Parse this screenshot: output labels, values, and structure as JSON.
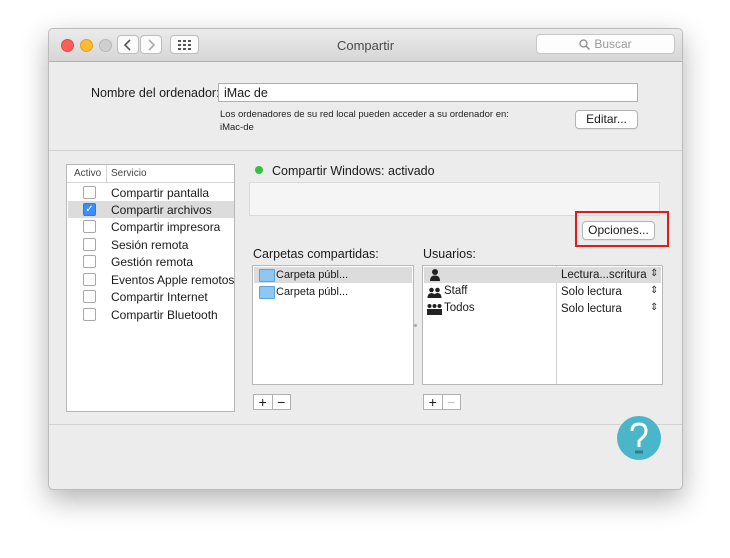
{
  "window": {
    "title": "Compartir"
  },
  "search": {
    "placeholder": "Buscar"
  },
  "computer_name": {
    "label": "Nombre del ordenador:",
    "value": "iMac de",
    "info_line1": "Los ordenadores de su red local pueden acceder a su ordenador en:",
    "info_line2": "iMac-de",
    "edit_button": "Editar..."
  },
  "services": {
    "header_active": "Activo",
    "header_service": "Servicio",
    "items": [
      {
        "label": "Compartir pantalla",
        "checked": false
      },
      {
        "label": "Compartir archivos",
        "checked": true
      },
      {
        "label": "Compartir impresora",
        "checked": false
      },
      {
        "label": "Sesión remota",
        "checked": false
      },
      {
        "label": "Gestión remota",
        "checked": false
      },
      {
        "label": "Eventos Apple remotos",
        "checked": false
      },
      {
        "label": "Compartir Internet",
        "checked": false
      },
      {
        "label": "Compartir Bluetooth",
        "checked": false
      }
    ]
  },
  "status": {
    "text": "Compartir Windows: activado",
    "color": "#2fc43b"
  },
  "options_button": "Opciones...",
  "shared_folders": {
    "label": "Carpetas compartidas:",
    "items": [
      "Carpeta públ...",
      "Carpeta públ..."
    ]
  },
  "users": {
    "label": "Usuarios:",
    "rows": [
      {
        "name": "",
        "permission": "Lectura...scritura"
      },
      {
        "name": "Staff",
        "permission": "Solo lectura"
      },
      {
        "name": "Todos",
        "permission": "Solo lectura"
      }
    ]
  },
  "accent": "#3b8ef4",
  "highlight_color": "#e21a1a"
}
